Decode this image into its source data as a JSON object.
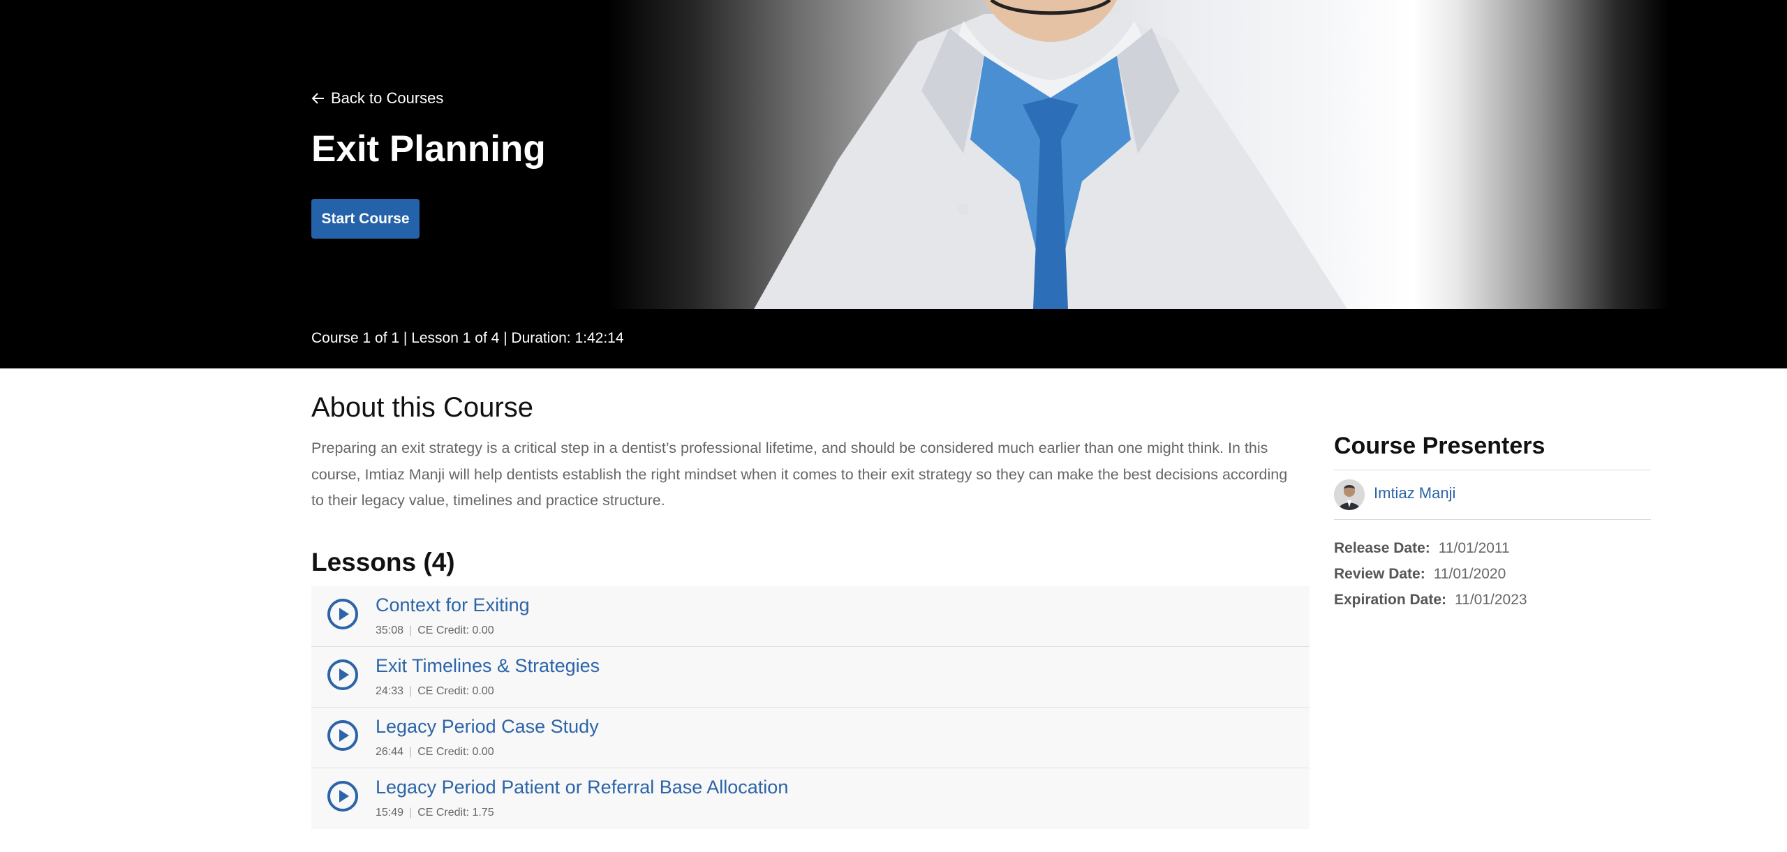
{
  "hero": {
    "back_label": "Back to Courses",
    "title": "Exit Planning",
    "start_button": "Start Course"
  },
  "meta": {
    "text": "Course 1 of 1 | Lesson 1 of 4 | Duration: 1:42:14"
  },
  "about": {
    "heading": "About this Course",
    "description": "Preparing an exit strategy is a critical step in a dentist’s professional lifetime, and should be considered much earlier than one might think. In this course, Imtiaz Manji will help dentists establish the right mindset when it comes to their exit strategy so they can make the best decisions according to their legacy value, timelines and practice structure."
  },
  "lessons": {
    "heading": "Lessons (4)",
    "items": [
      {
        "title": "Context for Exiting",
        "duration": "35:08",
        "credit": "CE Credit: 0.00"
      },
      {
        "title": "Exit Timelines & Strategies",
        "duration": "24:33",
        "credit": "CE Credit: 0.00"
      },
      {
        "title": "Legacy Period Case Study",
        "duration": "26:44",
        "credit": "CE Credit: 0.00"
      },
      {
        "title": "Legacy Period Patient or Referral Base Allocation",
        "duration": "15:49",
        "credit": "CE Credit: 1.75"
      }
    ]
  },
  "sidebar": {
    "presenters_heading": "Course Presenters",
    "presenter_name": "Imtiaz Manji",
    "release_label": "Release Date:",
    "release_value": "11/01/2011",
    "review_label": "Review Date:",
    "review_value": "11/01/2020",
    "expiration_label": "Expiration Date:",
    "expiration_value": "11/01/2023"
  },
  "colors": {
    "accent": "#2462aa",
    "link": "#2b64a8"
  },
  "icons": [
    "arrow-left-icon",
    "play-circle-icon",
    "avatar"
  ]
}
